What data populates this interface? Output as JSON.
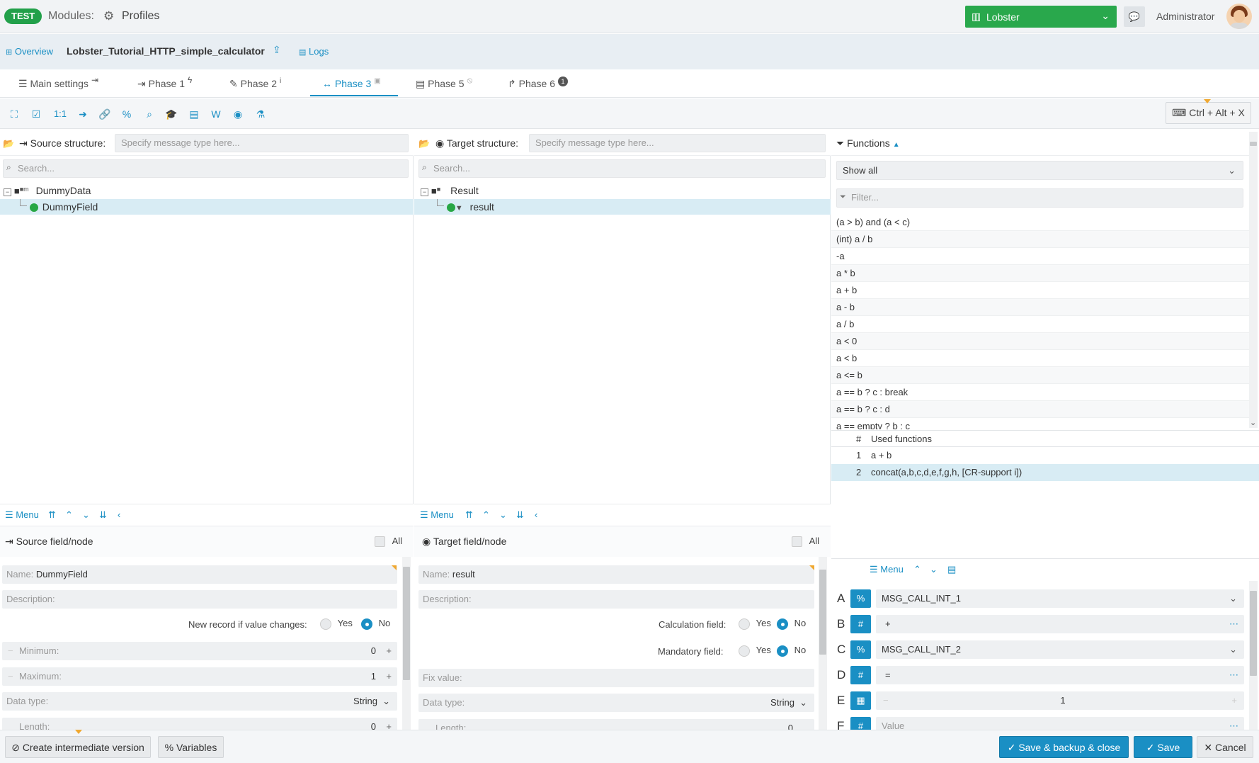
{
  "header": {
    "env_badge": "TEST",
    "modules_label": "Modules:",
    "module_name": "Profiles",
    "tenant": "Lobster",
    "user": "Administrator"
  },
  "subheader": {
    "overview": "Overview",
    "profile_name": "Lobster_Tutorial_HTTP_simple_calculator",
    "logs": "Logs"
  },
  "tabs": [
    {
      "label": "Main settings"
    },
    {
      "label": "Phase 1"
    },
    {
      "label": "Phase 2"
    },
    {
      "label": "Phase 3"
    },
    {
      "label": "Phase 5"
    },
    {
      "label": "Phase 6",
      "badge": "1"
    }
  ],
  "toolbar": {
    "one_to_one": "1:1",
    "shortcut": "Ctrl + Alt + X"
  },
  "source": {
    "label": "Source structure:",
    "placeholder": "Specify message type here...",
    "search_placeholder": "Search...",
    "tree": [
      {
        "name": "DummyData"
      },
      {
        "name": "DummyField"
      }
    ],
    "menu": "Menu",
    "node_title": "Source field/node",
    "all": "All",
    "fields": {
      "name_label": "Name:",
      "name_value": "DummyField",
      "description": "Description:",
      "new_record": "New record if value changes:",
      "yes": "Yes",
      "no": "No",
      "minimum": "Minimum:",
      "minimum_value": "0",
      "maximum": "Maximum:",
      "maximum_value": "1",
      "data_type": "Data type:",
      "data_type_value": "String",
      "length": "Length:",
      "length_value": "0"
    }
  },
  "target": {
    "label": "Target structure:",
    "placeholder": "Specify message type here...",
    "search_placeholder": "Search...",
    "tree": [
      {
        "name": "Result"
      },
      {
        "name": "result"
      }
    ],
    "menu": "Menu",
    "node_title": "Target field/node",
    "all": "All",
    "fields": {
      "name_label": "Name:",
      "name_value": "result",
      "description": "Description:",
      "calc_field": "Calculation field:",
      "mandatory_field": "Mandatory field:",
      "yes": "Yes",
      "no": "No",
      "fix_value": "Fix value:",
      "data_type": "Data type:",
      "data_type_value": "String",
      "length": "Length:",
      "length_value": "0"
    }
  },
  "functions": {
    "title": "Functions",
    "show_all": "Show all",
    "filter_placeholder": "Filter...",
    "list": [
      "(a > b) and (a < c)",
      "(int) a / b",
      "-a",
      "a * b",
      "a + b",
      "a - b",
      "a / b",
      "a < 0",
      "a < b",
      "a <= b",
      "a == b ? c : break",
      "a == b ? c : d",
      "a == empty ? b : c"
    ],
    "used_header_num": "#",
    "used_header": "Used functions",
    "used": [
      {
        "num": "1",
        "name": "a + b"
      },
      {
        "num": "2",
        "name": "concat(a,b,c,d,e,f,g,h, [CR-support i])"
      }
    ],
    "menu": "Menu",
    "params": [
      {
        "letter": "A",
        "btn": "%",
        "value": "MSG_CALL_INT_1"
      },
      {
        "letter": "B",
        "btn": "#",
        "value": "+"
      },
      {
        "letter": "C",
        "btn": "%",
        "value": "MSG_CALL_INT_2"
      },
      {
        "letter": "D",
        "btn": "#",
        "value": "="
      },
      {
        "letter": "E",
        "btn": "▦",
        "value": "1"
      },
      {
        "letter": "F",
        "btn": "#",
        "value": "Value"
      }
    ]
  },
  "footer": {
    "create_intermediate": "Create intermediate version",
    "variables": "Variables",
    "save_backup_close": "Save & backup & close",
    "save": "Save",
    "cancel": "Cancel"
  },
  "colors": {
    "accent": "#1a8fc4",
    "tenant_green": "#29a84c",
    "badge_green": "#22a04a",
    "selected_row": "#d8ecf4"
  }
}
